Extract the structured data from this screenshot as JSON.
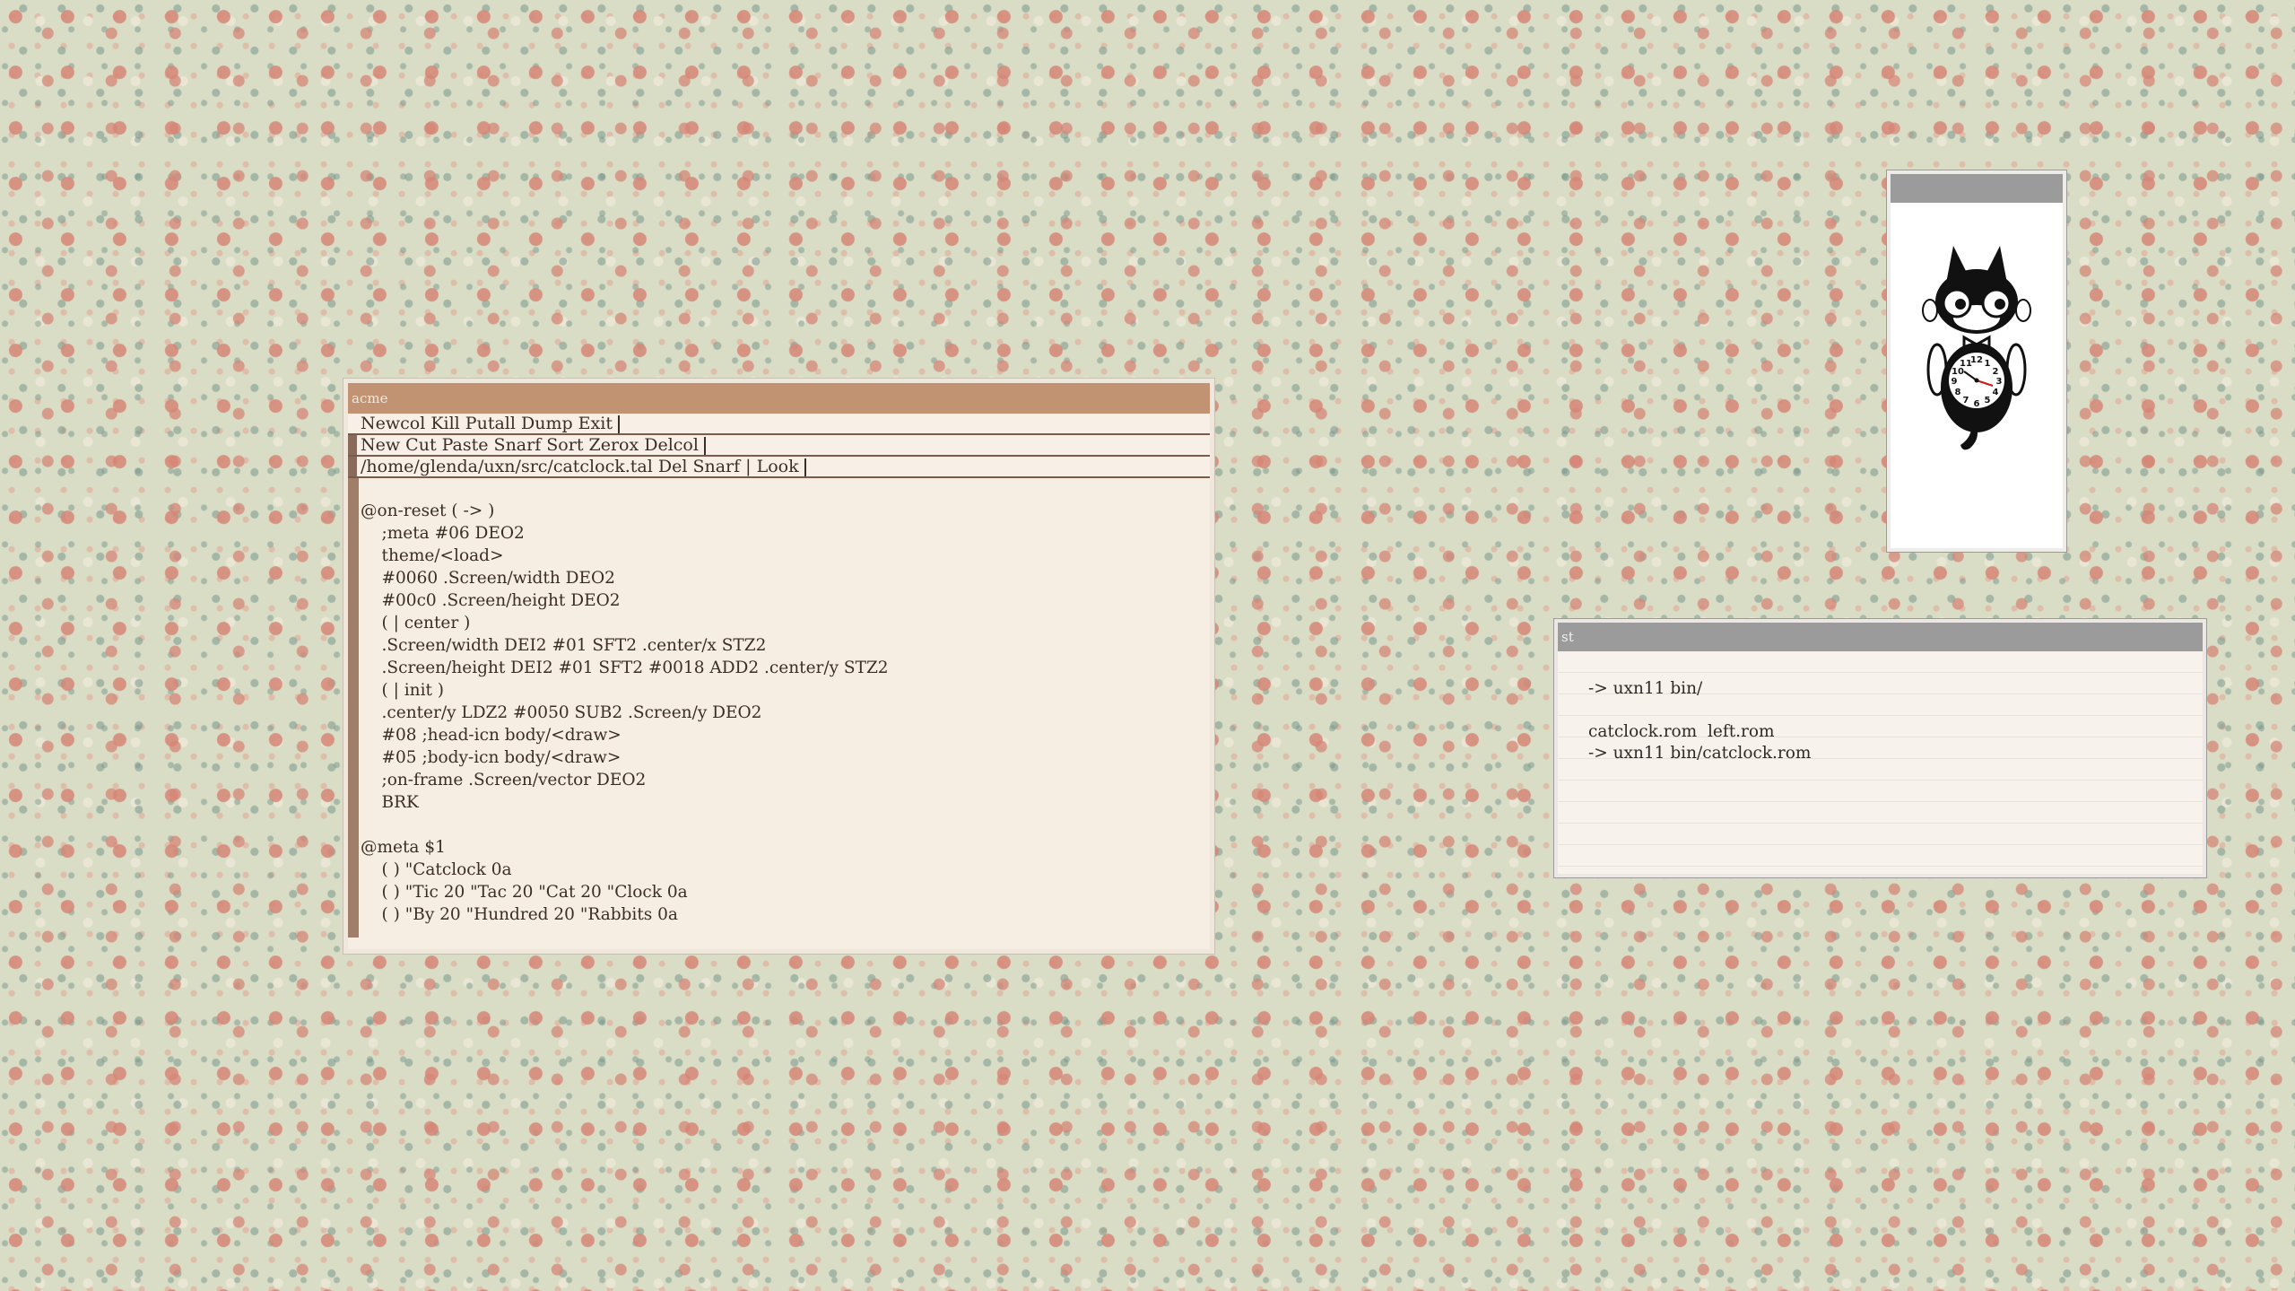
{
  "acme": {
    "title": "acme",
    "tag_main": "Newcol Kill Putall Dump Exit",
    "tag_column": "New Cut Paste Snarf Sort Zerox Delcol",
    "tag_window": "/home/glenda/uxn/src/catclock.tal Del Snarf | Look",
    "code": "@on-reset ( -> )\n    ;meta #06 DEO2\n    theme/<load>\n    #0060 .Screen/width DEO2\n    #00c0 .Screen/height DEO2\n    ( | center )\n    .Screen/width DEI2 #01 SFT2 .center/x STZ2\n    .Screen/height DEI2 #01 SFT2 #0018 ADD2 .center/y STZ2\n    ( | init )\n    .center/y LDZ2 #0050 SUB2 .Screen/y DEO2\n    #08 ;head-icn body/<draw>\n    #05 ;body-icn body/<draw>\n    ;on-frame .Screen/vector DEO2\n    BRK\n\n@meta $1\n    ( ) \"Catclock 0a\n    ( ) \"Tic 20 \"Tac 20 \"Cat 20 \"Clock 0a\n    ( ) \"By 20 \"Hundred 20 \"Rabbits 0a"
  },
  "catclock": {
    "title": "",
    "numbers": [
      "12",
      "1",
      "2",
      "3",
      "4",
      "5",
      "6",
      "7",
      "8",
      "9",
      "10",
      "11"
    ]
  },
  "st": {
    "title": "st",
    "output": "-> uxn11 bin/\n\ncatclock.rom  left.rom\n-> uxn11 bin/catclock.rom"
  }
}
